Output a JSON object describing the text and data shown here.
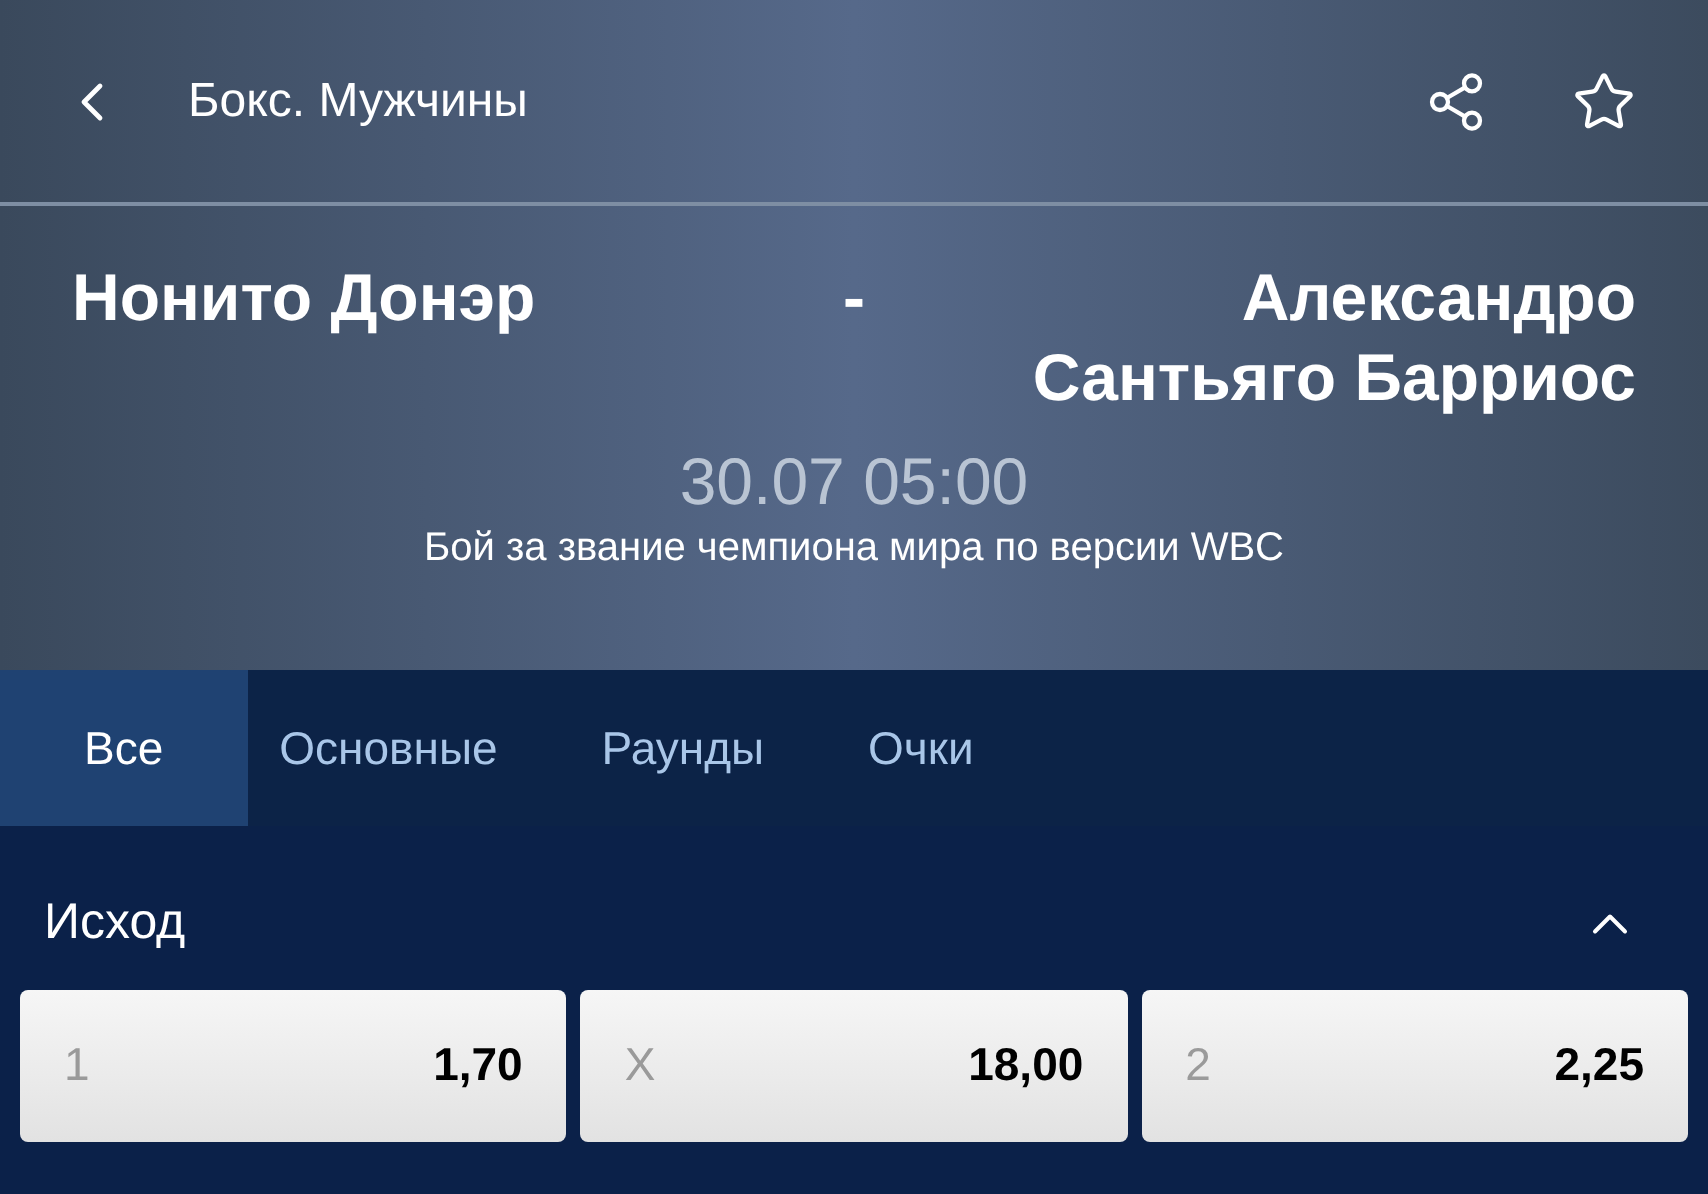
{
  "header": {
    "title": "Бокс. Мужчины"
  },
  "match": {
    "home": "Нонито Донэр",
    "separator": "-",
    "away": "Александро Сантьяго Барриос",
    "datetime": "30.07 05:00",
    "description": "Бой за звание чемпиона мира по версии WBC"
  },
  "tabs": [
    {
      "label": "Все",
      "selected": true
    },
    {
      "label": "Основные",
      "selected": false
    },
    {
      "label": "Раунды",
      "selected": false
    },
    {
      "label": "Очки",
      "selected": false
    }
  ],
  "market": {
    "title": "Исход",
    "expanded": true,
    "odds": [
      {
        "outcome": "1",
        "value": "1,70"
      },
      {
        "outcome": "X",
        "value": "18,00"
      },
      {
        "outcome": "2",
        "value": "2,25"
      }
    ]
  }
}
